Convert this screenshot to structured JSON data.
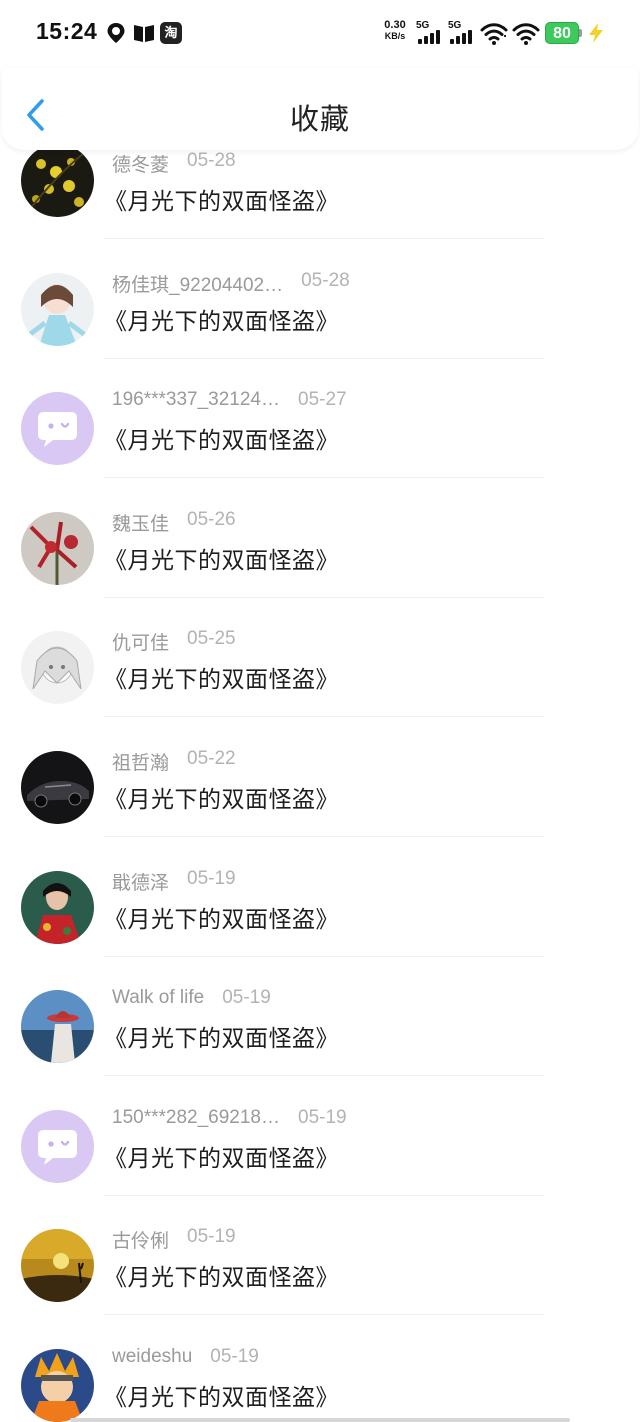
{
  "status_bar": {
    "time": "15:24",
    "net_speed_value": "0.30",
    "net_speed_unit": "KB/s",
    "signal_1_label": "5G",
    "signal_2_label": "5G",
    "battery": "80",
    "taobao_label": "淘",
    "icons": [
      "location-du-icon",
      "book-icon",
      "taobao-icon",
      "signal-icon",
      "signal-icon",
      "wifi-icon",
      "wifi-icon",
      "battery-icon",
      "charging-icon"
    ]
  },
  "header": {
    "title": "收藏",
    "back_icon": "chevron-left-icon",
    "back_color": "#2f9de8"
  },
  "items": [
    {
      "user": "德冬菱",
      "date": "05-28",
      "title": "《月光下的双面怪盗》",
      "avatar": "yellow-flowers"
    },
    {
      "user": "杨佳琪_92204402…",
      "date": "05-28",
      "title": "《月光下的双面怪盗》",
      "avatar": "anime-girl"
    },
    {
      "user": "196***337_32124…",
      "date": "05-27",
      "title": "《月光下的双面怪盗》",
      "avatar": "default-chat"
    },
    {
      "user": "魏玉佳",
      "date": "05-26",
      "title": "《月光下的双面怪盗》",
      "avatar": "red-flowers"
    },
    {
      "user": "仇可佳",
      "date": "05-25",
      "title": "《月光下的双面怪盗》",
      "avatar": "anime-sketch"
    },
    {
      "user": "祖哲瀚",
      "date": "05-22",
      "title": "《月光下的双面怪盗》",
      "avatar": "car"
    },
    {
      "user": "戢德泽",
      "date": "05-19",
      "title": "《月光下的双面怪盗》",
      "avatar": "woman-portrait"
    },
    {
      "user": "Walk of life",
      "date": "05-19",
      "title": "《月光下的双面怪盗》",
      "avatar": "seaside-hat"
    },
    {
      "user": "150***282_69218…",
      "date": "05-19",
      "title": "《月光下的双面怪盗》",
      "avatar": "default-chat"
    },
    {
      "user": "古伶俐",
      "date": "05-19",
      "title": "《月光下的双面怪盗》",
      "avatar": "sunset"
    },
    {
      "user": "weideshu",
      "date": "05-19",
      "title": "《月光下的双面怪盗》",
      "avatar": "anime-ninja"
    }
  ],
  "colors": {
    "default_avatar_bg": "#d9c8f4",
    "battery_green": "#3dc95c",
    "charge_yellow": "#f2d22a"
  }
}
